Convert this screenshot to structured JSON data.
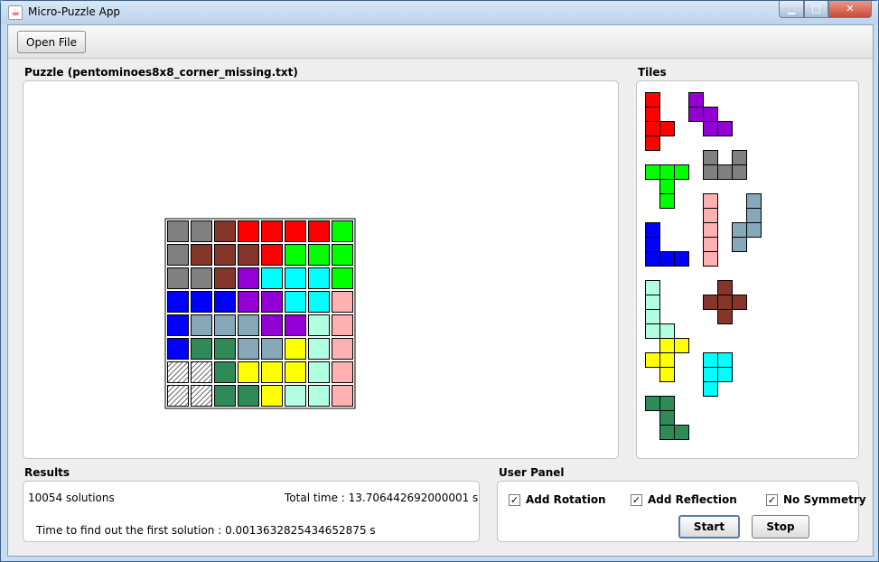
{
  "window": {
    "title": "Micro-Puzzle App",
    "min": "▁",
    "max": "□",
    "close": "✕"
  },
  "toolbar": {
    "open_file_label": "Open File"
  },
  "puzzle": {
    "title": "Puzzle (pentominoes8x8_corner_missing.txt)",
    "grid": [
      [
        "gray",
        "gray",
        "brown",
        "red",
        "red",
        "red",
        "red",
        "green"
      ],
      [
        "gray",
        "brown",
        "brown",
        "brown",
        "red",
        "green",
        "green",
        "green"
      ],
      [
        "gray",
        "gray",
        "brown",
        "purple",
        "cyan",
        "cyan",
        "cyan",
        "green"
      ],
      [
        "blue",
        "blue",
        "blue",
        "purple",
        "purple",
        "cyan",
        "cyan",
        "pink"
      ],
      [
        "blue",
        "steel",
        "steel",
        "steel",
        "purple",
        "purple",
        "mint",
        "pink"
      ],
      [
        "blue",
        "dkgreen",
        "dkgreen",
        "steel",
        "steel",
        "yellow",
        "mint",
        "pink"
      ],
      [
        "hatch",
        "hatch",
        "dkgreen",
        "yellow",
        "yellow",
        "yellow",
        "mint",
        "pink"
      ],
      [
        "hatch",
        "hatch",
        "dkgreen",
        "dkgreen",
        "yellow",
        "mint",
        "mint",
        "pink"
      ]
    ]
  },
  "colors": {
    "gray": "#808080",
    "brown": "#85352a",
    "red": "#ff0000",
    "green": "#00ff00",
    "purple": "#9400d3",
    "cyan": "#00ffff",
    "blue": "#0000ff",
    "pink": "#ffb0b0",
    "steel": "#86a8b8",
    "mint": "#b0ffe0",
    "dkgreen": "#2e8b57",
    "yellow": "#ffff00"
  },
  "tiles": {
    "title": "Tiles",
    "pieces": [
      {
        "color": "red",
        "cells": [
          [
            0,
            0
          ],
          [
            0,
            1
          ],
          [
            0,
            2
          ],
          [
            1,
            2
          ],
          [
            0,
            3
          ]
        ]
      },
      {
        "color": "purple",
        "cells": [
          [
            0,
            0
          ],
          [
            0,
            1
          ],
          [
            1,
            1
          ],
          [
            1,
            2
          ],
          [
            2,
            2
          ]
        ]
      },
      {
        "color": "gray",
        "cells": [
          [
            0,
            0
          ],
          [
            2,
            0
          ],
          [
            0,
            1
          ],
          [
            1,
            1
          ],
          [
            2,
            1
          ]
        ]
      },
      {
        "color": "green",
        "cells": [
          [
            0,
            0
          ],
          [
            1,
            0
          ],
          [
            2,
            0
          ],
          [
            1,
            1
          ],
          [
            1,
            2
          ]
        ]
      },
      {
        "color": "pink",
        "cells": [
          [
            0,
            0
          ],
          [
            0,
            1
          ],
          [
            0,
            2
          ],
          [
            0,
            3
          ],
          [
            0,
            4
          ]
        ]
      },
      {
        "color": "steel",
        "cells": [
          [
            1,
            0
          ],
          [
            1,
            1
          ],
          [
            0,
            2
          ],
          [
            1,
            2
          ],
          [
            0,
            3
          ]
        ]
      },
      {
        "color": "blue",
        "cells": [
          [
            0,
            0
          ],
          [
            0,
            1
          ],
          [
            0,
            2
          ],
          [
            1,
            2
          ],
          [
            2,
            2
          ]
        ]
      },
      {
        "color": "brown",
        "cells": [
          [
            1,
            0
          ],
          [
            0,
            1
          ],
          [
            1,
            1
          ],
          [
            2,
            1
          ],
          [
            1,
            2
          ]
        ]
      },
      {
        "color": "mint",
        "cells": [
          [
            0,
            0
          ],
          [
            0,
            1
          ],
          [
            0,
            2
          ],
          [
            0,
            3
          ],
          [
            1,
            3
          ]
        ]
      },
      {
        "color": "yellow",
        "cells": [
          [
            1,
            0
          ],
          [
            2,
            0
          ],
          [
            0,
            1
          ],
          [
            1,
            1
          ],
          [
            1,
            2
          ]
        ]
      },
      {
        "color": "cyan",
        "cells": [
          [
            0,
            0
          ],
          [
            1,
            0
          ],
          [
            0,
            1
          ],
          [
            1,
            1
          ],
          [
            0,
            2
          ]
        ]
      },
      {
        "color": "dkgreen",
        "cells": [
          [
            0,
            0
          ],
          [
            1,
            0
          ],
          [
            1,
            1
          ],
          [
            1,
            2
          ],
          [
            2,
            2
          ]
        ]
      }
    ]
  },
  "results": {
    "title": "Results",
    "solutions": "10054 solutions",
    "total_time": "Total time : 13.706442692000001 s",
    "first_time": "Time to find out the first solution : 0.0013632825434652875 s"
  },
  "user_panel": {
    "title": "User Panel",
    "add_rotation": {
      "label": "Add Rotation",
      "checked": true
    },
    "add_reflection": {
      "label": "Add Reflection",
      "checked": true
    },
    "no_symmetry": {
      "label": "No Symmetry",
      "checked": true
    },
    "start_label": "Start",
    "stop_label": "Stop"
  }
}
